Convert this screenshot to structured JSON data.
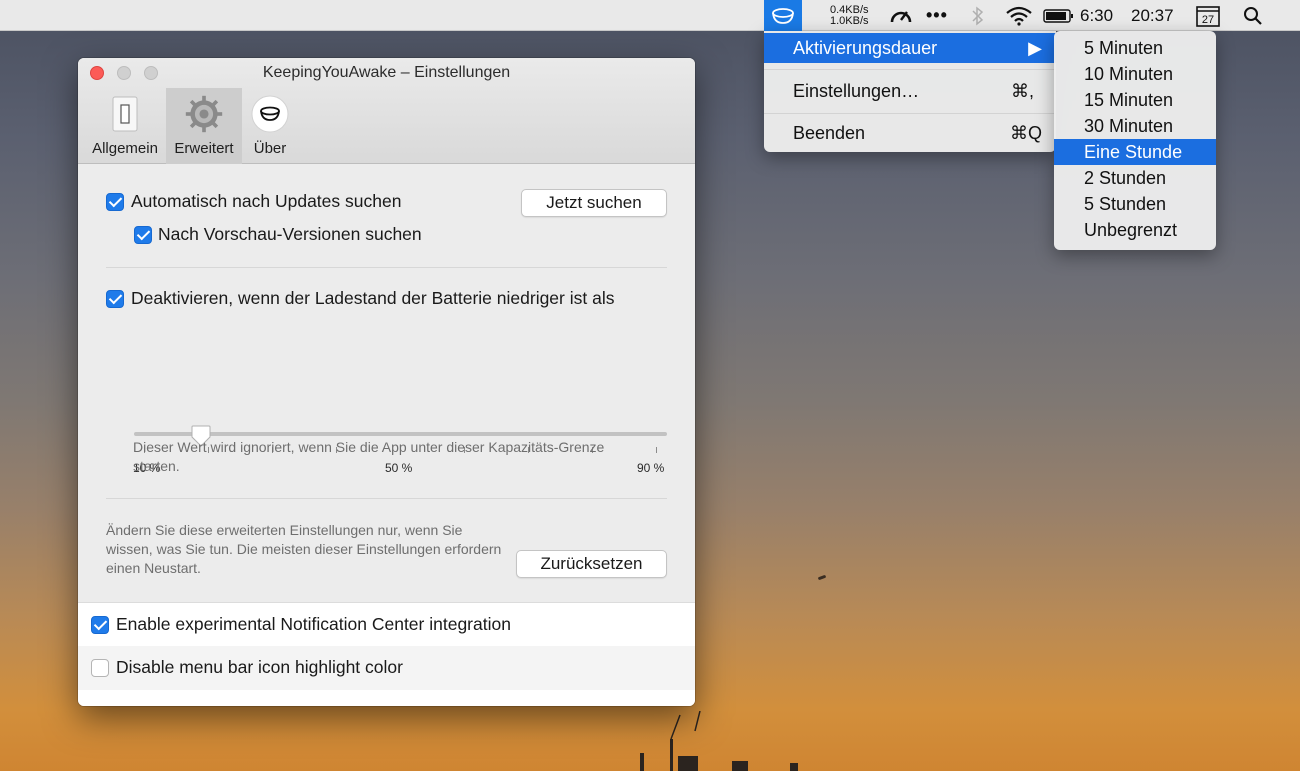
{
  "menubar": {
    "net_up": "0.4KB/s",
    "net_down": "1.0KB/s",
    "dots": "•••",
    "battery_time": "6:30",
    "clock": "20:37",
    "calendar_day": "27"
  },
  "menu": {
    "items": [
      {
        "label": "Aktivierungsdauer",
        "shortcut": "▶"
      },
      {
        "label": "Einstellungen…",
        "shortcut": "⌘,"
      },
      {
        "label": "Beenden",
        "shortcut": "⌘Q"
      }
    ]
  },
  "submenu": {
    "items": [
      "5 Minuten",
      "10 Minuten",
      "15 Minuten",
      "30 Minuten",
      "Eine Stunde",
      "2 Stunden",
      "5 Stunden",
      "Unbegrenzt"
    ],
    "selected": "Eine Stunde"
  },
  "window": {
    "title": "KeepingYouAwake – Einstellungen",
    "tabs": [
      "Allgemein",
      "Erweitert",
      "Über"
    ]
  },
  "settings": {
    "auto_update_label": "Automatisch nach Updates suchen",
    "auto_update_checked": true,
    "check_now_button": "Jetzt suchen",
    "preview_label": "Nach Vorschau-Versionen suchen",
    "preview_checked": true,
    "battery_label": "Deaktivieren, wenn der Ladestand der Batterie niedriger ist als",
    "battery_checked": true,
    "slider": {
      "min_label": "10 %",
      "mid_label": "50 %",
      "max_label": "90 %",
      "value_percent": 20
    },
    "battery_note": "Dieser Wert wird ignoriert, wenn Sie die App unter dieser Kapazitäts-Grenze starten.",
    "advanced_note": "Ändern Sie diese erweiterten Einstellungen nur, wenn Sie wissen, was Sie tun. Die meisten dieser Einstellungen erfordern einen Neustart.",
    "reset_button": "Zurücksetzen",
    "notification_label": "Enable experimental Notification Center integration",
    "notification_checked": true,
    "highlight_label": "Disable menu bar icon highlight color",
    "highlight_checked": false
  },
  "colors": {
    "accent": "#1b6ee0",
    "checkbox": "#1f7bea",
    "close": "#fc5b57"
  }
}
